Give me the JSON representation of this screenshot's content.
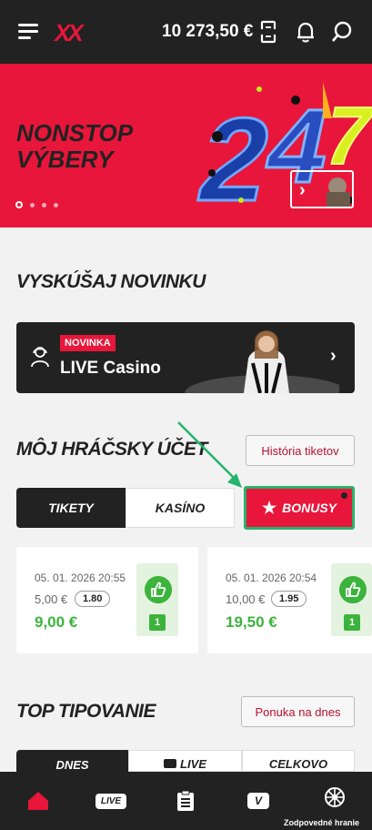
{
  "header": {
    "logo": "XX",
    "balance": "10 273,50 €"
  },
  "banner": {
    "title": "NONSTOP VÝBERY",
    "artwork_text": "24/7",
    "slides": 4,
    "active_slide": 1
  },
  "new_section": {
    "title": "VYSKÚŠAJ NOVINKU",
    "promo": {
      "badge": "NOVINKA",
      "label": "LIVE Casino"
    }
  },
  "account": {
    "title": "MÔJ HRÁČSKY ÚČET",
    "history_button": "História tiketov",
    "tabs": [
      {
        "label": "TIKETY"
      },
      {
        "label": "KASÍNO"
      },
      {
        "label": "BONUSY"
      }
    ],
    "tickets": [
      {
        "date": "05. 01. 2026 20:55",
        "stake": "5,00 €",
        "odds": "1.80",
        "win": "9,00 €",
        "count": "1"
      },
      {
        "date": "05. 01. 2026 20:54",
        "stake": "10,00 €",
        "odds": "1.95",
        "win": "19,50 €",
        "count": "1"
      }
    ]
  },
  "top_tips": {
    "title": "TOP TIPOVANIE",
    "offer_button": "Ponuka na dnes",
    "tabs": [
      {
        "label": "DNES"
      },
      {
        "label": "LIVE"
      },
      {
        "label": "CELKOVO"
      }
    ]
  },
  "bottom_nav": {
    "live_label": "LIVE",
    "v_label": "V",
    "responsible_label": "Zodpovedné hranie"
  },
  "colors": {
    "accent": "#e8163a",
    "dark": "#222222",
    "success": "#3cb33c",
    "highlight": "#26b36b"
  }
}
